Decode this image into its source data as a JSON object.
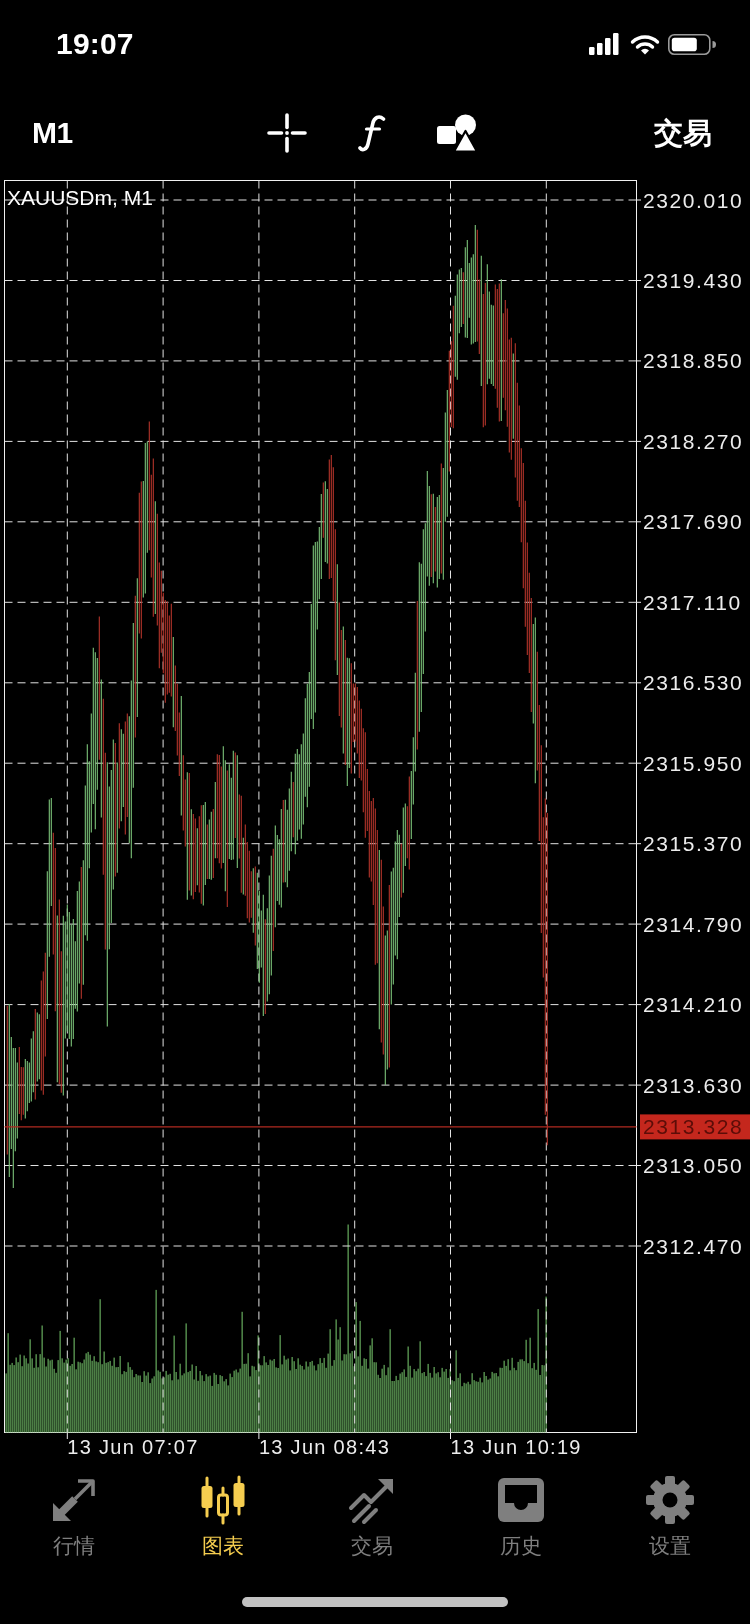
{
  "status_bar": {
    "time": "19:07"
  },
  "toolbar": {
    "timeframe": "M1",
    "trade": "交易"
  },
  "chart": {
    "title": "XAUUSDm, M1",
    "price_labels": [
      "2320.010",
      "2319.430",
      "2318.850",
      "2318.270",
      "2317.690",
      "2317.110",
      "2316.530",
      "2315.950",
      "2315.370",
      "2314.790",
      "2314.210",
      "2313.630",
      "2313.050",
      "2312.470"
    ],
    "current_price": "2313.328",
    "time_labels": [
      "13 Jun 07:07",
      "13 Jun 08:43",
      "13 Jun 10:19"
    ]
  },
  "tab_bar": {
    "tabs": [
      {
        "label": "行情",
        "selected": false
      },
      {
        "label": "图表",
        "selected": true
      },
      {
        "label": "交易",
        "selected": false
      },
      {
        "label": "历史",
        "selected": false
      },
      {
        "label": "设置",
        "selected": false
      }
    ]
  }
}
